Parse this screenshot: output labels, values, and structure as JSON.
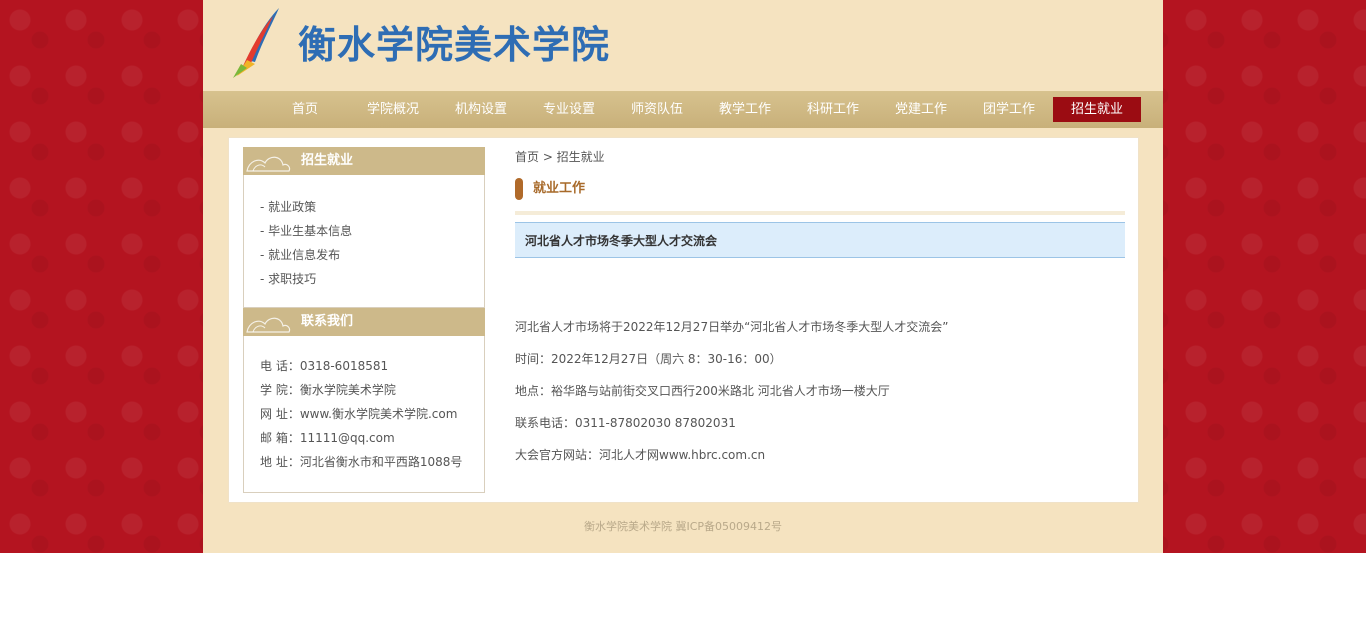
{
  "header": {
    "logo_text": "衡水学院美术学院"
  },
  "nav": {
    "items": [
      "首页",
      "学院概况",
      "机构设置",
      "专业设置",
      "师资队伍",
      "教学工作",
      "科研工作",
      "党建工作",
      "团学工作",
      "招生就业"
    ],
    "active_index": 9
  },
  "sidebar": {
    "section_title": "招生就业",
    "items": [
      "- 就业政策",
      "- 毕业生基本信息",
      "- 就业信息发布",
      "- 求职技巧"
    ],
    "contact_title": "联系我们",
    "contact": [
      "电 话：0318-6018581",
      "学 院：衡水学院美术学院",
      "网 址：www.衡水学院美术学院.com",
      "邮 箱：11111@qq.com",
      "地 址：河北省衡水市和平西路1088号"
    ]
  },
  "main": {
    "breadcrumb": "首页 > 招生就业",
    "section_title": "就业工作",
    "article_title": "河北省人才市场冬季大型人才交流会",
    "paragraphs": [
      "河北省人才市场将于2022年12月27日举办“河北省人才市场冬季大型人才交流会”",
      "时间：2022年12月27日（周六 8：30-16：00）",
      "地点：裕华路与站前街交叉口西行200米路北 河北省人才市场一楼大厅",
      "联系电话：0311-87802030  87802031",
      "大会官方网站：河北人才网www.hbrc.com.cn"
    ]
  },
  "footer": {
    "text": "衡水学院美术学院 冀ICP备05009412号"
  },
  "colors": {
    "nav_active": "#9b0c12",
    "background": "#b41420",
    "panel": "#f5e3c0",
    "logo": "#2e6db4"
  },
  "icons": {
    "logo": "rocket-logo-icon",
    "side_ornament": "cloud-ornament-icon"
  }
}
